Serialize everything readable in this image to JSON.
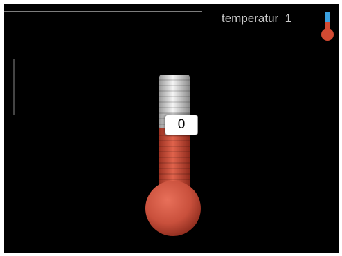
{
  "header": {
    "title": "temperatur",
    "number": "1",
    "icon": "thermometer-icon"
  },
  "thermometer": {
    "value": "0",
    "fill_fraction": 0.62,
    "colors": {
      "fill": "#c9503c",
      "empty": "#d8d8d8",
      "background": "#000000"
    }
  }
}
